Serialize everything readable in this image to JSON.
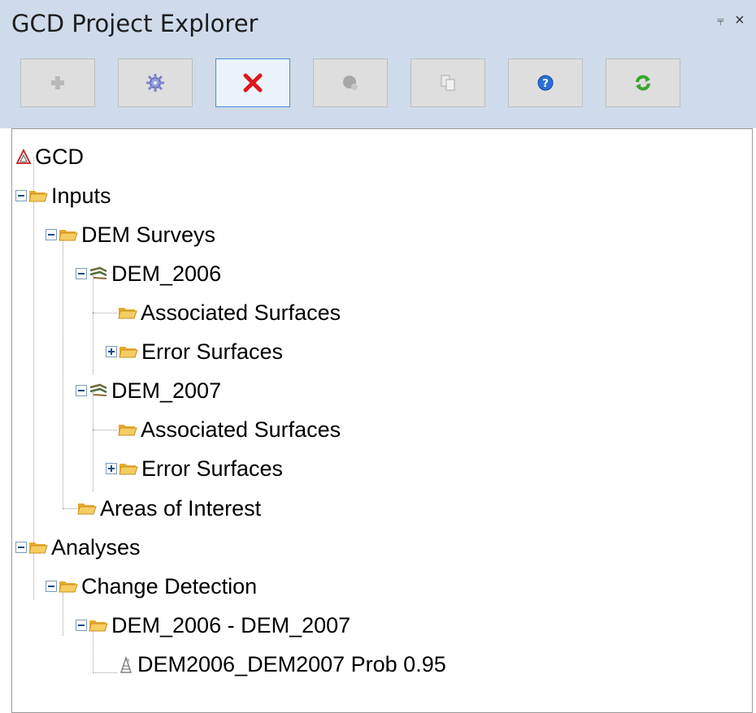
{
  "panel": {
    "title": "GCD Project Explorer",
    "pin_glyph": "⫧",
    "close_glyph": "×"
  },
  "toolbar": {
    "buttons": [
      {
        "name": "add-button",
        "icon": "plus-icon",
        "enabled": false
      },
      {
        "name": "properties-button",
        "icon": "gear-icon",
        "enabled": true
      },
      {
        "name": "delete-button",
        "icon": "red-x-icon",
        "enabled": true,
        "selected": true
      },
      {
        "name": "add-layer-button",
        "icon": "globe-add-icon",
        "enabled": false
      },
      {
        "name": "copy-button",
        "icon": "copy-icon",
        "enabled": false
      },
      {
        "name": "help-button",
        "icon": "help-icon",
        "enabled": true
      },
      {
        "name": "refresh-button",
        "icon": "refresh-icon",
        "enabled": true
      }
    ]
  },
  "tree": {
    "nodes": [
      {
        "label": "GCD",
        "icon": "project-icon"
      },
      {
        "label": "Inputs",
        "icon": "folder-icon",
        "expander": "minus"
      },
      {
        "label": "DEM Surveys",
        "icon": "folder-icon",
        "expander": "minus"
      },
      {
        "label": "DEM_2006",
        "icon": "dem-icon",
        "expander": "minus"
      },
      {
        "label": "Associated Surfaces",
        "icon": "folder-icon"
      },
      {
        "label": "Error Surfaces",
        "icon": "folder-icon",
        "expander": "plus"
      },
      {
        "label": "DEM_2007",
        "icon": "dem-icon",
        "expander": "minus"
      },
      {
        "label": "Associated Surfaces",
        "icon": "folder-icon"
      },
      {
        "label": "Error Surfaces",
        "icon": "folder-icon",
        "expander": "plus"
      },
      {
        "label": "Areas of Interest",
        "icon": "folder-icon"
      },
      {
        "label": "Analyses",
        "icon": "folder-icon",
        "expander": "minus"
      },
      {
        "label": "Change Detection",
        "icon": "folder-icon",
        "expander": "minus"
      },
      {
        "label": "DEM_2006 - DEM_2007",
        "icon": "folder-icon",
        "expander": "minus"
      },
      {
        "label": "DEM2006_DEM2007 Prob 0.95",
        "icon": "dod-icon"
      }
    ]
  },
  "colors": {
    "header_bg": "#cfdbea",
    "folder": "#f2c14e",
    "delete_red": "#e0161b",
    "refresh_green": "#37a62c",
    "help_blue": "#2b6fd6"
  }
}
